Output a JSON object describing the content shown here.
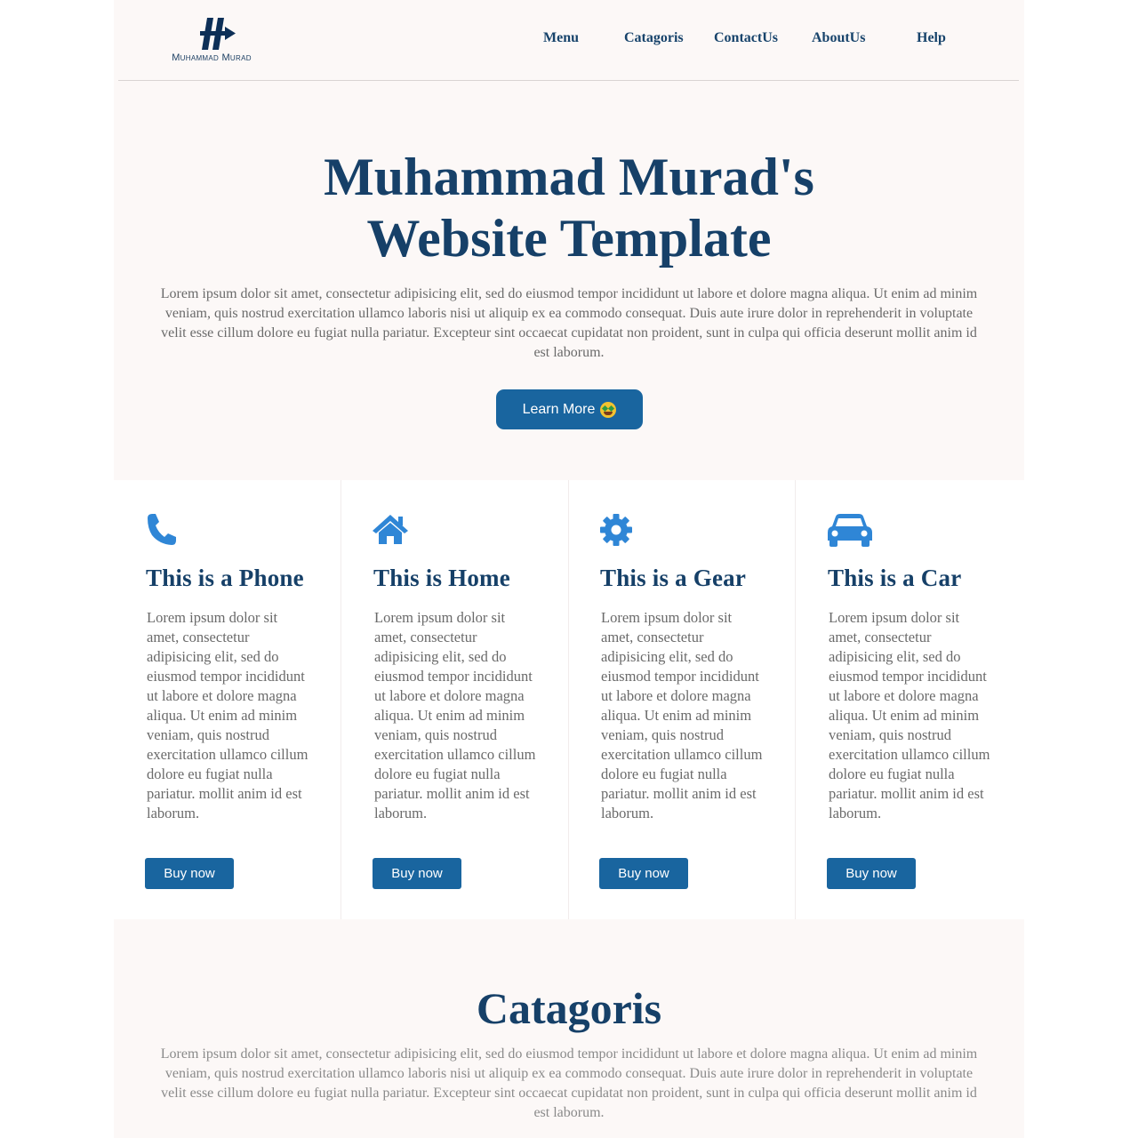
{
  "brand": {
    "name": "Muhammad Murad"
  },
  "nav": [
    "Menu",
    "Catagoris",
    "ContactUs",
    "AboutUs",
    "Help"
  ],
  "hero": {
    "title_line1": "Muhammad Murad's",
    "title_line2": "Website Template",
    "text": "Lorem ipsum dolor sit amet, consectetur adipisicing elit, sed do eiusmod tempor incididunt ut labore et dolore magna aliqua. Ut enim ad minim veniam, quis nostrud exercitation ullamco laboris nisi ut aliquip ex ea commodo consequat. Duis aute irure dolor in reprehenderit in voluptate velit esse cillum dolore eu fugiat nulla pariatur. Excepteur sint occaecat cupidatat non proident, sunt in culpa qui officia deserunt mollit anim id est laborum.",
    "button_label": "Learn More",
    "button_icon": "money-mouth-face-emoji"
  },
  "cards": [
    {
      "icon": "phone-icon",
      "title": "This is a Phone",
      "text": "Lorem ipsum dolor sit amet, consectetur adipisicing elit, sed do eiusmod tempor incididunt ut labore et dolore magna aliqua. Ut enim ad minim veniam, quis nostrud exercitation ullamco cillum dolore eu fugiat nulla pariatur. mollit anim id est laborum.",
      "button": "Buy now"
    },
    {
      "icon": "home-icon",
      "title": "This is Home",
      "text": "Lorem ipsum dolor sit amet, consectetur adipisicing elit, sed do eiusmod tempor incididunt ut labore et dolore magna aliqua. Ut enim ad minim veniam, quis nostrud exercitation ullamco cillum dolore eu fugiat nulla pariatur. mollit anim id est laborum.",
      "button": "Buy now"
    },
    {
      "icon": "gear-icon",
      "title": "This is a Gear",
      "text": "Lorem ipsum dolor sit amet, consectetur adipisicing elit, sed do eiusmod tempor incididunt ut labore et dolore magna aliqua. Ut enim ad minim veniam, quis nostrud exercitation ullamco cillum dolore eu fugiat nulla pariatur. mollit anim id est laborum.",
      "button": "Buy now"
    },
    {
      "icon": "car-icon",
      "title": "This is a Car",
      "text": "Lorem ipsum dolor sit amet, consectetur adipisicing elit, sed do eiusmod tempor incididunt ut labore et dolore magna aliqua. Ut enim ad minim veniam, quis nostrud exercitation ullamco cillum dolore eu fugiat nulla pariatur. mollit anim id est laborum.",
      "button": "Buy now"
    }
  ],
  "categories": {
    "title": "Catagoris",
    "text": "Lorem ipsum dolor sit amet, consectetur adipisicing elit, sed do eiusmod tempor incididunt ut labore et dolore magna aliqua. Ut enim ad minim veniam, quis nostrud exercitation ullamco laboris nisi ut aliquip ex ea commodo consequat. Duis aute irure dolor in reprehenderit in voluptate velit esse cillum dolore eu fugiat nulla pariatur. Excepteur sint occaecat cupidatat non proident, sunt in culpa qui officia deserunt mollit anim id est laborum."
  },
  "colors": {
    "primary": "#19659f",
    "heading": "#164068",
    "icon": "#2f86d6",
    "background": "#fcf8f7"
  }
}
